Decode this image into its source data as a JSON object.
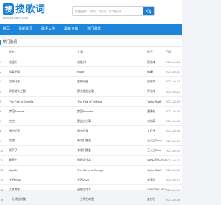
{
  "header": {
    "logo_mark": "搜",
    "logo_text": "搜歌词",
    "logo_sub": "www.sougeci.com",
    "search_placeholder": "歌曲名称、歌手、歌词、专辑名称",
    "search_icon": "search-icon"
  },
  "nav": {
    "items": [
      {
        "label": "首页"
      },
      {
        "label": "最新歌词"
      },
      {
        "label": "歌手大全"
      },
      {
        "label": "最新专辑"
      },
      {
        "label": "热门歌单"
      }
    ]
  },
  "panel": {
    "title": "热门歌词",
    "columns": [
      "",
      "歌名",
      "专辑",
      "歌手",
      "日期"
    ],
    "rows": [
      {
        "idx": "1",
        "title": "北极村",
        "album": "北极村",
        "singer": "蔡伟锋",
        "time": "2021-10-11"
      },
      {
        "idx": "2",
        "title": "错爱的诺",
        "album": "Rose",
        "singer": "林峰",
        "time": "2021-10-10"
      },
      {
        "idx": "3",
        "title": "爱情讯息",
        "album": "爱情讯息",
        "singer": "郑秀文",
        "time": "2021-10-13"
      },
      {
        "idx": "4",
        "title": "那些婚礼之歌",
        "album": "那些婚礼之歌",
        "singer": "罗志祥",
        "time": "2021-10-12"
      },
      {
        "idx": "5",
        "title": "The Fate of Ophelia",
        "album": "The Fate of Ophelia",
        "singer": "Taylor Swift",
        "time": "2021-10-09"
      },
      {
        "idx": "6",
        "title": "梦回Brownie",
        "album": "梦回Brownie",
        "singer": "潘玮柏",
        "time": "2021-10-09"
      },
      {
        "idx": "7",
        "title": "空空",
        "album": "那此大小事",
        "singer": "刘若英",
        "time": "2021-10-06"
      },
      {
        "idx": "8",
        "title": "周杰伦我",
        "album": "周杰伦我",
        "singer": "艾伦伟",
        "time": "2021-10-06"
      },
      {
        "idx": "9",
        "title": "黑桃",
        "album": "有我们最爱",
        "singer": "王火山Dean",
        "time": "2021-10-09"
      },
      {
        "idx": "10",
        "title": "烦不了",
        "album": "有我们最爱",
        "singer": "王火山Dean",
        "time": "2021-10-09"
      },
      {
        "idx": "11",
        "title": "鞍天村",
        "album": "道能冷冷本",
        "singer": "SANO阿KURO",
        "time": "2021-10-07"
      },
      {
        "idx": "12",
        "title": "Opalite",
        "album": "The Life of a Showgirl",
        "singer": "Taylor Swift",
        "time": "2021-10-13"
      },
      {
        "idx": "13",
        "title": "光阴2025",
        "album": "光阴2025",
        "singer": "李荣浩",
        "time": "2021-10-07"
      },
      {
        "idx": "14",
        "title": "大东南客",
        "album": "道能冷冷本",
        "singer": "SANO阿KURO",
        "time": "2021-10-07"
      },
      {
        "idx": "15",
        "title": "一分钟后的我",
        "album": "一分钟后的我",
        "singer": "龙杉杉",
        "time": "2021-10-08"
      }
    ]
  }
}
